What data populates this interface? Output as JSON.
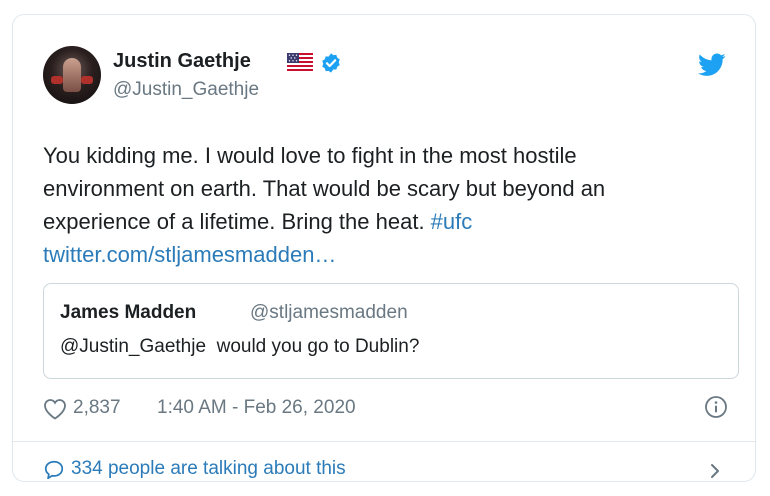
{
  "author": {
    "name": "Justin Gaethje",
    "handle": "@Justin_Gaethje",
    "flag_icon": "us-flag-icon",
    "verified_icon": "verified-badge-icon"
  },
  "tweet": {
    "text": "You kidding me. I would love to fight in the most hostile\nenvironment on earth. That would be scary but beyond an\nexperience of a lifetime. Bring the heat. ",
    "hashtag": "#ufc",
    "link": "twitter.com/stljamesmadden…"
  },
  "quoted": {
    "name": "James Madden",
    "handle": "@stljamesmadden",
    "text": "@Justin_Gaethje  would you go to Dublin?"
  },
  "meta": {
    "likes": "2,837",
    "timestamp": "1:40 AM - Feb 26, 2020"
  },
  "footer": {
    "talking": "334 people are talking about this"
  },
  "colors": {
    "link": "#2b7bb9",
    "muted": "#697882",
    "twitter_blue": "#1da1f2"
  }
}
